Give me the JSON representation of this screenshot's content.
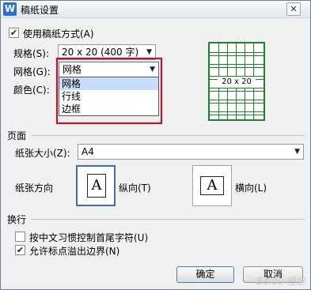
{
  "title": "稿纸设置",
  "app_icon": "W",
  "close_glyph": "✕",
  "use_grid": {
    "label": "使用稿纸方式(A)",
    "checked": true
  },
  "spec": {
    "label": "规格(S):",
    "value": "20 x 20 (400 字)"
  },
  "grid": {
    "label": "网格(G):",
    "value": "网格",
    "options": [
      "网格",
      "行线",
      "边框"
    ],
    "selected_index": 0
  },
  "color": {
    "label": "颜色(C):"
  },
  "preview": {
    "label": "20 x 20",
    "accent": "#19862a"
  },
  "page_section": {
    "title": "页面",
    "paper_size_label": "纸张大小(Z):",
    "paper_size_value": "A4",
    "orientation_label": "纸张方向",
    "portrait_label": "纵向(T)",
    "landscape_label": "横向(L)",
    "paper_glyph": "A"
  },
  "wrap_section": {
    "title": "换行",
    "option1": {
      "label": "按中文习惯控制首尾字符(U)",
      "checked": false
    },
    "option2": {
      "label": "允许标点溢出边界(N)",
      "checked": true
    }
  },
  "buttons": {
    "ok": "确定",
    "cancel": "取消"
  },
  "watermark": "Baidu 经验",
  "highlight_color": "#e4001b"
}
